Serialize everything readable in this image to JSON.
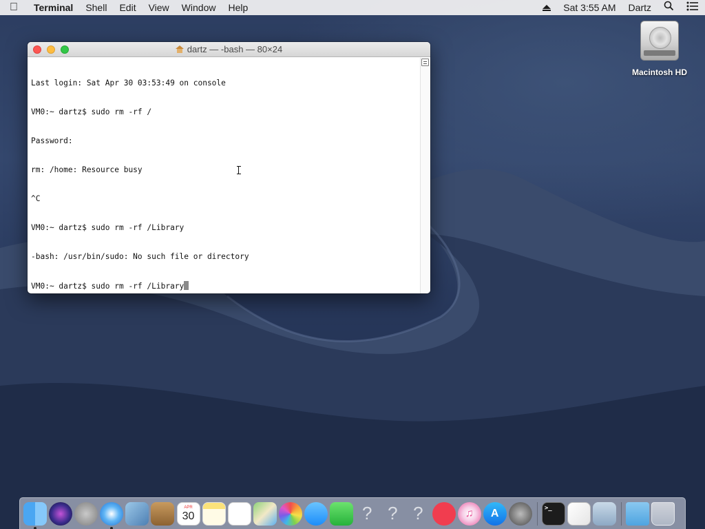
{
  "menubar": {
    "app_name": "Terminal",
    "menus": [
      "Shell",
      "Edit",
      "View",
      "Window",
      "Help"
    ],
    "clock": "Sat 3:55 AM",
    "user": "Dartz"
  },
  "desktop": {
    "hd_label": "Macintosh HD"
  },
  "terminal": {
    "title": "dartz — -bash — 80×24",
    "lines": [
      "Last login: Sat Apr 30 03:53:49 on console",
      "VM0:~ dartz$ sudo rm -rf /",
      "Password:",
      "rm: /home: Resource busy",
      "^C",
      "VM0:~ dartz$ sudo rm -rf /Library",
      "-bash: /usr/bin/sudo: No such file or directory",
      "VM0:~ dartz$ sudo rm -rf /Library"
    ]
  },
  "dock": {
    "calendar_month": "APR",
    "calendar_day": "30",
    "terminal_prompt": ">_",
    "unknown_glyph": "?",
    "itunes_glyph": "♫",
    "appstore_glyph": "A"
  },
  "colors": {
    "close": "#fc5753",
    "minimize": "#fdbc40",
    "zoom": "#33c748"
  }
}
